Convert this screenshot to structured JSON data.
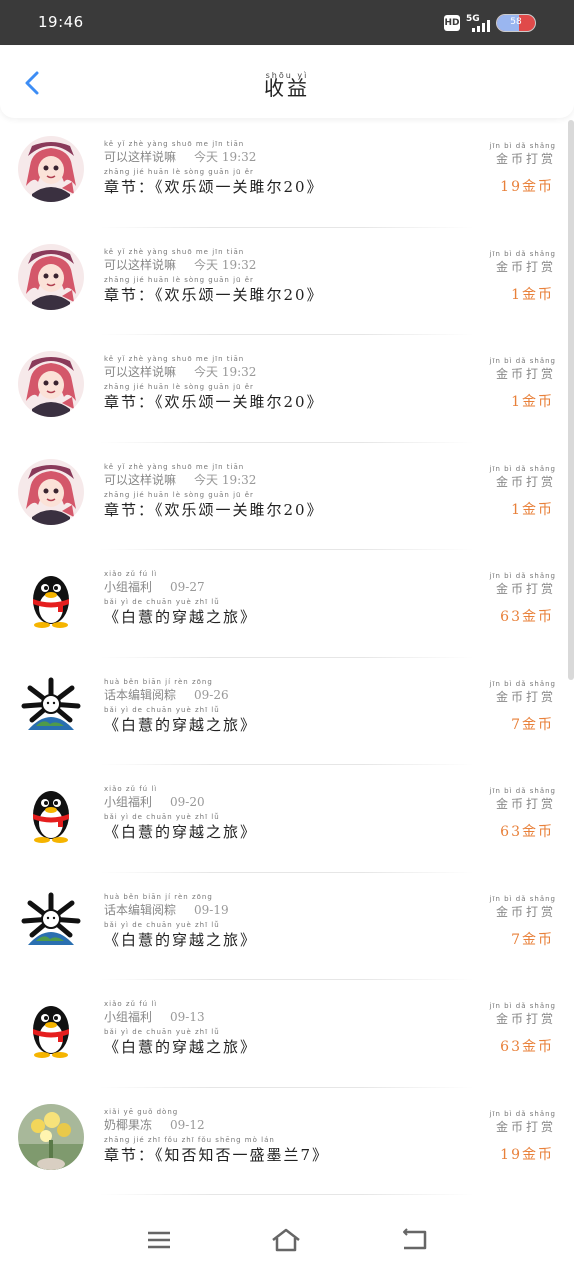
{
  "status_bar": {
    "time": "19:46",
    "hd_label": "HD",
    "network_label": "5G",
    "battery_level": "58",
    "battery_fraction": 0.58
  },
  "header": {
    "title": "收益",
    "title_pinyin": "shōu  yì",
    "back_icon": "chevron-left-icon"
  },
  "colors": {
    "accent": "#3d8df5",
    "amount": "#e8803a",
    "status_bar_bg": "#3a3a3a"
  },
  "records": [
    {
      "avatar": "anime-girl",
      "meta_pinyin": "kě   yǐ  zhè  yàng  shuō  me            jīn   tiān",
      "source": "可以这样说嘛",
      "time": "今天 19:32",
      "desc_pinyin": "zhāng  jié             huān   lè  sòng          guān  jū   ěr",
      "desc": "章节：《欢乐颂一关雎尔20》",
      "type": "金币打赏",
      "amount": "19金币"
    },
    {
      "avatar": "anime-girl",
      "meta_pinyin": "kě   yǐ  zhè  yàng  shuō  me            jīn   tiān",
      "source": "可以这样说嘛",
      "time": "今天 19:32",
      "desc_pinyin": "zhāng  jié             huān   lè  sòng          guān  jū   ěr",
      "desc": "章节：《欢乐颂一关雎尔20》",
      "type": "金币打赏",
      "amount": "1金币"
    },
    {
      "avatar": "anime-girl",
      "meta_pinyin": "kě   yǐ  zhè  yàng  shuō  me            jīn   tiān",
      "source": "可以这样说嘛",
      "time": "今天 19:32",
      "desc_pinyin": "zhāng  jié             huān   lè  sòng          guān  jū   ěr",
      "desc": "章节：《欢乐颂一关雎尔20》",
      "type": "金币打赏",
      "amount": "1金币"
    },
    {
      "avatar": "anime-girl",
      "meta_pinyin": "kě   yǐ  zhè  yàng  shuō  me            jīn   tiān",
      "source": "可以这样说嘛",
      "time": "今天 19:32",
      "desc_pinyin": "zhāng  jié             huān   lè  sòng          guān  jū   ěr",
      "desc": "章节：《欢乐颂一关雎尔20》",
      "type": "金币打赏",
      "amount": "1金币"
    },
    {
      "avatar": "penguin",
      "meta_pinyin": "xiǎo  zǔ   fú   lì",
      "source": "小组福利",
      "time": "09-27",
      "desc_pinyin": "          bǎi      yì      de   chuān  yuè   zhī   lǚ",
      "desc": "《白薏的穿越之旅》",
      "type": "金币打赏",
      "amount": "63金币"
    },
    {
      "avatar": "globe-bones",
      "meta_pinyin": "huà  běn  biān  jí   rèn  zōng",
      "source": "话本编辑阅粽",
      "time": "09-26",
      "desc_pinyin": "          bǎi      yì      de   chuān  yuè   zhī   lǚ",
      "desc": "《白薏的穿越之旅》",
      "type": "金币打赏",
      "amount": "7金币"
    },
    {
      "avatar": "penguin",
      "meta_pinyin": "xiǎo  zǔ   fú   lì",
      "source": "小组福利",
      "time": "09-20",
      "desc_pinyin": "          bǎi      yì      de   chuān  yuè   zhī   lǚ",
      "desc": "《白薏的穿越之旅》",
      "type": "金币打赏",
      "amount": "63金币"
    },
    {
      "avatar": "globe-bones",
      "meta_pinyin": "huà  běn  biān  jí   rèn  zōng",
      "source": "话本编辑阅粽",
      "time": "09-19",
      "desc_pinyin": "          bǎi      yì      de   chuān  yuè   zhī   lǚ",
      "desc": "《白薏的穿越之旅》",
      "type": "金币打赏",
      "amount": "7金币"
    },
    {
      "avatar": "penguin",
      "meta_pinyin": "xiǎo  zǔ   fú   lì",
      "source": "小组福利",
      "time": "09-13",
      "desc_pinyin": "          bǎi      yì      de   chuān  yuè   zhī   lǚ",
      "desc": "《白薏的穿越之旅》",
      "type": "金币打赏",
      "amount": "63金币"
    },
    {
      "avatar": "flowers-photo",
      "meta_pinyin": "xiǎi  yē  guǒ  dòng",
      "source": "奶椰果冻",
      "time": "09-12",
      "desc_pinyin": "zhāng  jié             zhī  fǒu  zhī  fǒu         shēng  mò   lán",
      "desc": "章节：《知否知否一盛墨兰7》",
      "type": "金币打赏",
      "amount": "19金币"
    }
  ],
  "type_pinyin": "jīn   bì   dǎ  shǎng",
  "nav": {
    "menu_icon": "menu-icon",
    "home_icon": "home-icon",
    "back_icon": "back-icon"
  }
}
